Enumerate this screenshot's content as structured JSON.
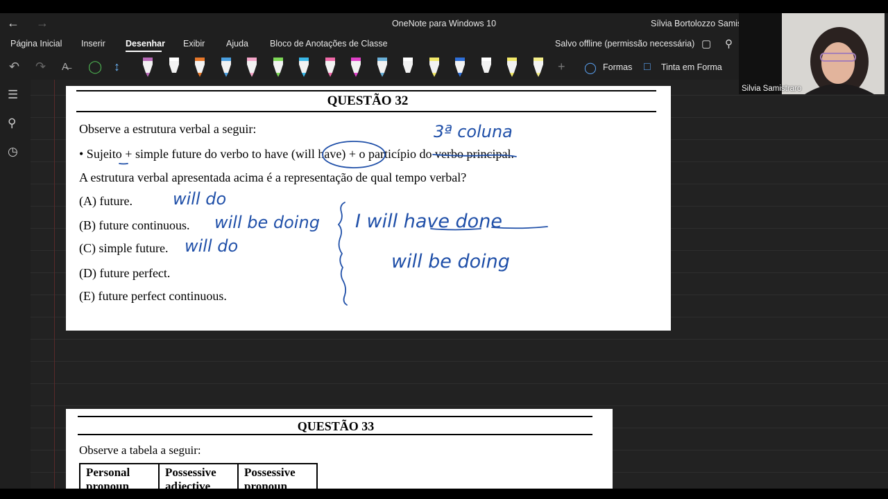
{
  "app": {
    "title": "OneNote para Windows 10",
    "user": "Sílvia Bortolozzo Samist"
  },
  "menu": {
    "items": [
      "Página Inicial",
      "Inserir",
      "Desenhar",
      "Exibir",
      "Ajuda",
      "Bloco de Anotações de Classe"
    ],
    "active": "Desenhar",
    "status": "Salvo offline (permissão necessária)"
  },
  "toolbar": {
    "shapes_label": "Formas",
    "ink_to_shape_label": "Tinta em Forma",
    "pens": [
      {
        "color": "#b86bb8"
      },
      {
        "color": "#ffffff"
      },
      {
        "color": "#e8782a"
      },
      {
        "color": "#4a9fe0"
      },
      {
        "color": "#f4a6c8"
      },
      {
        "color": "#7ed957"
      },
      {
        "color": "#3ab8e8"
      },
      {
        "color": "#f06aa8"
      },
      {
        "color": "#e040c8"
      },
      {
        "color": "#6ab0d8"
      },
      {
        "color": "#ffffff"
      },
      {
        "color": "#f2e96a"
      },
      {
        "color": "#2f6fd8"
      },
      {
        "color": "#ffffff"
      },
      {
        "color": "#f2e96a"
      },
      {
        "color": "#f5ef8a"
      }
    ],
    "selected_pen_index": 12
  },
  "webcam": {
    "name": "Silvia Samistraro"
  },
  "q32": {
    "title": "QUESTÃO 32",
    "intro": "Observe a estrutura verbal a seguir:",
    "bullet_a": "• Sujeito + simple future do verbo to have ",
    "bullet_b": "(will have)",
    "bullet_c": " + o particípio do verbo principal.",
    "question": "A estrutura verbal apresentada acima é a representação de qual tempo verbal?",
    "options": [
      "(A) future.",
      "(B) future continuous.",
      "(C) simple future.",
      "(D) future perfect.",
      "(E) future perfect continuous."
    ]
  },
  "handwriting": {
    "col3": "3ª coluna",
    "a": "will do",
    "b": "will be doing",
    "c": "will do",
    "right1": "I will have done",
    "right2": "will be doing"
  },
  "q33": {
    "title": "QUESTÃO 33",
    "intro": "Observe a tabela a seguir:",
    "headers": [
      "Personal pronoun",
      "Possessive adjective",
      "Possessive pronoun"
    ]
  },
  "colors": {
    "ink": "#1f4fa8",
    "app_bg": "#1f1f1f",
    "canvas_bg": "#222222"
  }
}
